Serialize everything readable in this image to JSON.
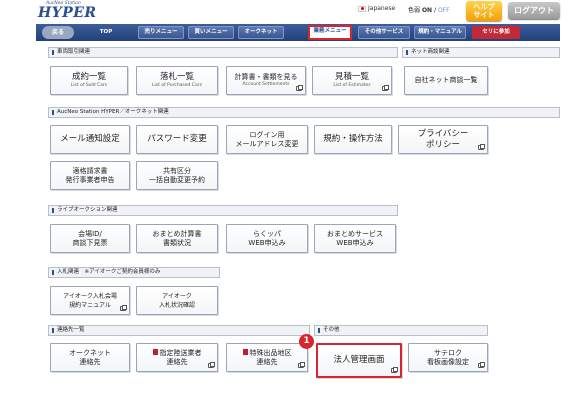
{
  "header": {
    "logo_small": "AucNeo Station",
    "logo_main": "HYPER",
    "language": "Japanese",
    "colorblind_label": "色弱",
    "colorblind_on": "ON",
    "colorblind_off": "OFF",
    "help_line1": "ヘルプ",
    "help_line2": "サイト",
    "logout": "ログアウト"
  },
  "nav": {
    "back": "戻る",
    "items": [
      "TOP",
      "売りメニュー",
      "買いメニュー",
      "オークネット",
      "業務メニュー",
      "その他サービス",
      "規約・マニュアル",
      "セリに参加"
    ]
  },
  "sections": {
    "vehicle_trade": "車両取引関連",
    "net_deals": "ネット商談関連",
    "aucneo": "AucNeo Station HYPER／オークネット関連",
    "live_auction": "ライブオークション関連",
    "entry": "入札関連　※アイオークご契約会員様のみ",
    "contacts": "連絡先一覧",
    "other": "その他"
  },
  "buttons": {
    "contract_list": {
      "main": "成約一覧",
      "sub": "List of Sold Cars"
    },
    "win_list": {
      "main": "落札一覧",
      "sub": "List of Purchased Cars"
    },
    "statements": {
      "main": "計算書・書類を見る",
      "sub": "Account Settlements"
    },
    "estimates": {
      "main": "見積一覧",
      "sub": "List of Estimates"
    },
    "own_net_deals": {
      "main": "自社ネット商談一覧"
    },
    "mail_notice": {
      "main": "メール通知設定"
    },
    "password_change": {
      "main": "パスワード変更"
    },
    "login_mail_line1": "ログイン用",
    "login_mail_line2": "メールアドレス変更",
    "terms": {
      "main": "規約・操作方法"
    },
    "privacy_line1": "プライバシー",
    "privacy_line2": "ポリシー",
    "invoice_line1": "適格請求書",
    "invoice_line2": "発行事業者申告",
    "shared_line1": "共有区分",
    "shared_line2": "一括自動変更予約",
    "member_id_line1": "会場ID/",
    "member_id_line2": "商談下見票",
    "summary_line1": "おまとめ計算書",
    "summary_line2": "書類状況",
    "rakuppa_line1": "らくッパ",
    "rakuppa_line2": "WEB申込み",
    "summary_service_line1": "おまとめサービス",
    "summary_service_line2": "WEB申込み",
    "ioke_manual_line1": "アイオーク入札会場",
    "ioke_manual_line2": "規約マニュアル",
    "ioke_status_line1": "アイオーク",
    "ioke_status_line2": "入札状況確認",
    "auctionet_contact_line1": "オークネット",
    "auctionet_contact_line2": "連絡先",
    "carrier_line1": "指定陸送業者",
    "carrier_line2": "連絡先",
    "special_line1": "特殊出品地区",
    "special_line2": "連絡先",
    "corp_admin": {
      "main": "法人管理画面"
    },
    "satecrow_line1": "サテロク",
    "satecrow_line2": "看板画像設定"
  },
  "badge": "1",
  "colors": {
    "nav_bg": "#2c4a86",
    "highlight": "#d8262e",
    "accent": "#2c4f8f"
  }
}
